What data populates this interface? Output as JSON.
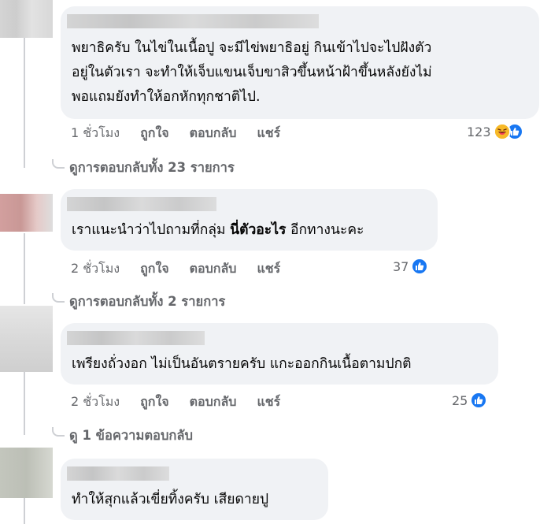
{
  "comments": [
    {
      "lines": [
        "พยาธิครับ ในไข่ในเนื้อปู จะมีไข่พยาธิอยู่ กินเข้าไปจะไปฝังตัว",
        "อยู่ในตัวเรา จะทำให้เจ็บแขนเจ็บขาสิวขึ้นหน้าฝ้าขึ้นหลังยังไม่",
        "พอแถมยังทำให้อกหักทุกชาติไป."
      ],
      "time": "1 ชั่วโมง",
      "reaction_count": "123",
      "reactions": [
        "haha-icon",
        "like-icon"
      ],
      "view_replies": "ดูการตอบกลับทั้ง 23 รายการ"
    },
    {
      "text_plain": "เราแนะนำว่าไปถามที่กลุ่ม ",
      "text_bold": "นี่ตัวอะไร",
      "text_tail": " อีกทางนะคะ",
      "time": "2 ชั่วโมง",
      "reaction_count": "37",
      "reactions": [
        "like-icon"
      ],
      "view_replies": "ดูการตอบกลับทั้ง 2 รายการ"
    },
    {
      "text": "เพรียงถั่วงอก ไม่เป็นอันตรายครับ แกะออกกินเนื้อตามปกติ",
      "time": "2 ชั่วโมง",
      "reaction_count": "25",
      "reactions": [
        "like-icon"
      ],
      "view_replies": "ดู 1 ข้อความตอบกลับ"
    },
    {
      "text": "ทำให้สุกแล้วเขี่ยทิ้งครับ เสียดายปู"
    }
  ],
  "actions": {
    "like": "ถูกใจ",
    "reply": "ตอบกลับ",
    "share": "แชร์"
  },
  "colors": {
    "bubble": "#f0f2f5",
    "meta_text": "#65676b",
    "like_blue": "#1877f2",
    "haha_yellow": "#f7b928"
  }
}
